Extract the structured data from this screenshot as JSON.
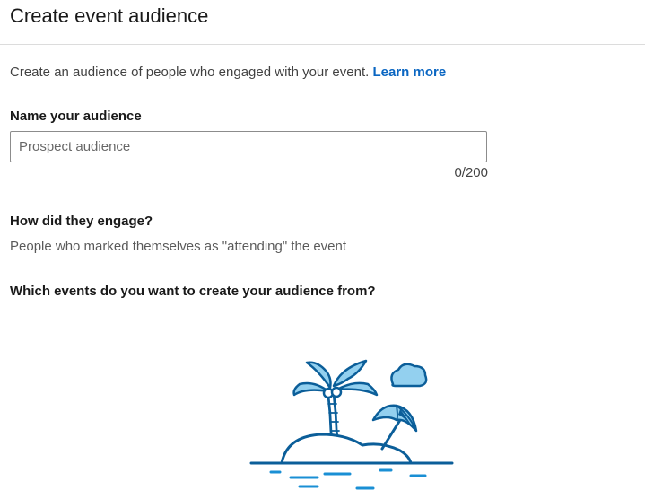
{
  "header": {
    "title": "Create event audience"
  },
  "intro": {
    "text": "Create an audience of people who engaged with your event.",
    "link": "Learn more"
  },
  "name_field": {
    "label": "Name your audience",
    "placeholder": "Prospect audience",
    "value": "",
    "counter": "0/200"
  },
  "engagement": {
    "heading": "How did they engage?",
    "description": "People who marked themselves as \"attending\" the event"
  },
  "events": {
    "heading": "Which events do you want to create your audience from?"
  },
  "illustration": {
    "icon": "beach-island-illustration",
    "colors": {
      "outline": "#0b5e99",
      "fill": "#93d0ef"
    }
  }
}
